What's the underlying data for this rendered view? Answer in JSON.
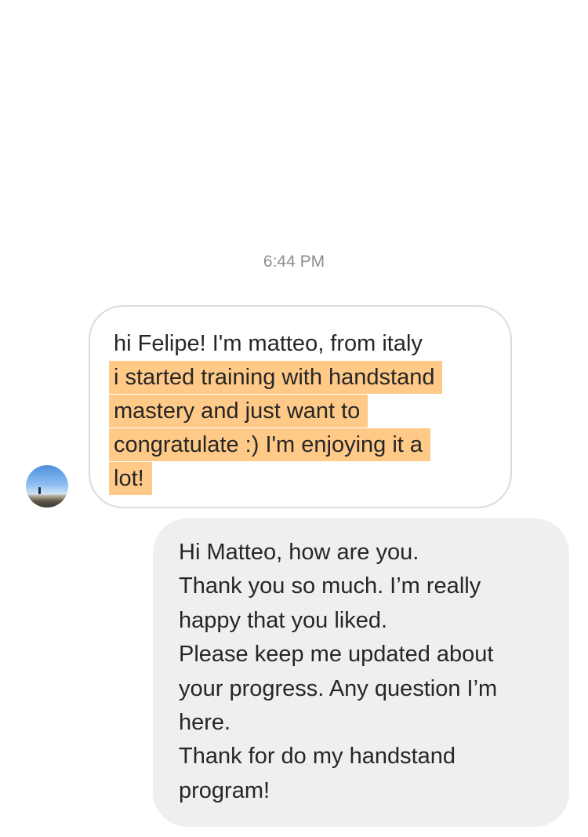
{
  "conversation": {
    "timestamp": "6:44 PM",
    "incoming_message": {
      "avatar_icon": "user-avatar-photo",
      "first_line": "hi Felipe! I'm matteo, from italy",
      "highlighted_lines": [
        "i started training with handstand",
        "mastery and just want to",
        "congratulate :) I'm enjoying it a",
        "lot!"
      ],
      "highlight_color": "#ffc987"
    },
    "outgoing_message": {
      "lines": [
        "Hi Matteo, how are you.",
        "Thank you so much. I’m really",
        "happy that you liked.",
        "Please keep me updated about",
        "your progress. Any question I’m",
        "here.",
        "Thank for do my handstand",
        "program!"
      ],
      "bubble_color": "#efefef"
    }
  }
}
